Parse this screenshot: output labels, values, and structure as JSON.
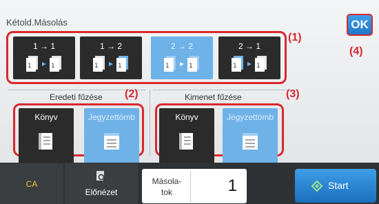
{
  "title": "Kétold.Másolás",
  "ok_label": "OK",
  "modes": [
    {
      "label": "1 → 1"
    },
    {
      "label": "1 → 2"
    },
    {
      "label": "2 → 2"
    },
    {
      "label": "2 → 1"
    }
  ],
  "callouts": {
    "c1": "(1)",
    "c2": "(2)",
    "c3": "(3)",
    "c4": "(4)"
  },
  "original_binding": {
    "title": "Eredeti fűzése",
    "options": [
      "Könyv",
      "Jegyzettömb"
    ]
  },
  "output_binding": {
    "title": "Kimenet fűzése",
    "options": [
      "Könyv",
      "Jegyzettömb"
    ]
  },
  "bottom": {
    "ca": "CA",
    "preview": "Előnézet",
    "copies_label_1": "Másola-",
    "copies_label_2": "tok",
    "copies_value": "1",
    "start": "Start"
  },
  "colors": {
    "selected": "#6fb2e8",
    "dark": "#2b2b2b",
    "accent_red": "#d8282e",
    "start_blue": "#2a86d8"
  }
}
